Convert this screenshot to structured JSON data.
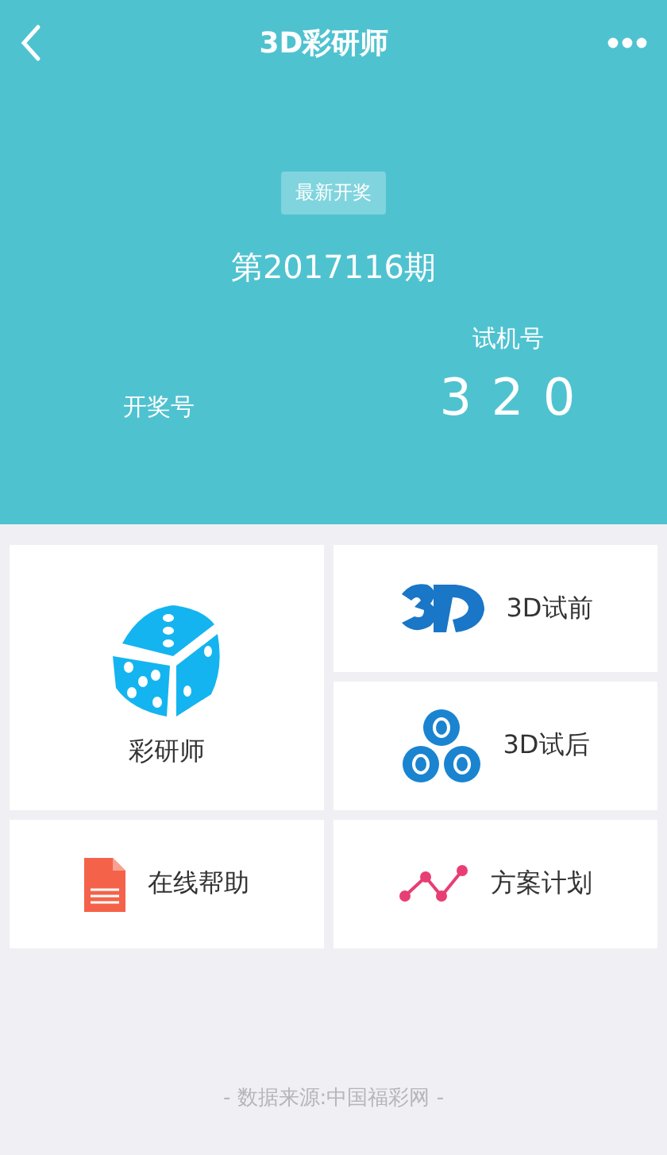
{
  "nav": {
    "title": "3D彩研师"
  },
  "header": {
    "badge": "最新开奖",
    "issue": "第2017116期",
    "draw_label": "开奖号",
    "test_label": "试机号",
    "test_number": "3 2 0"
  },
  "tiles": [
    {
      "kind": "dice",
      "label": "彩研师"
    },
    {
      "kind": "logo3d",
      "label": "3D试前"
    },
    {
      "kind": "balls",
      "label": "3D试后"
    },
    {
      "kind": "doc",
      "label": "在线帮助"
    },
    {
      "kind": "trend",
      "label": "方案计划"
    }
  ],
  "footer": "- 数据来源:中国福彩网 -"
}
